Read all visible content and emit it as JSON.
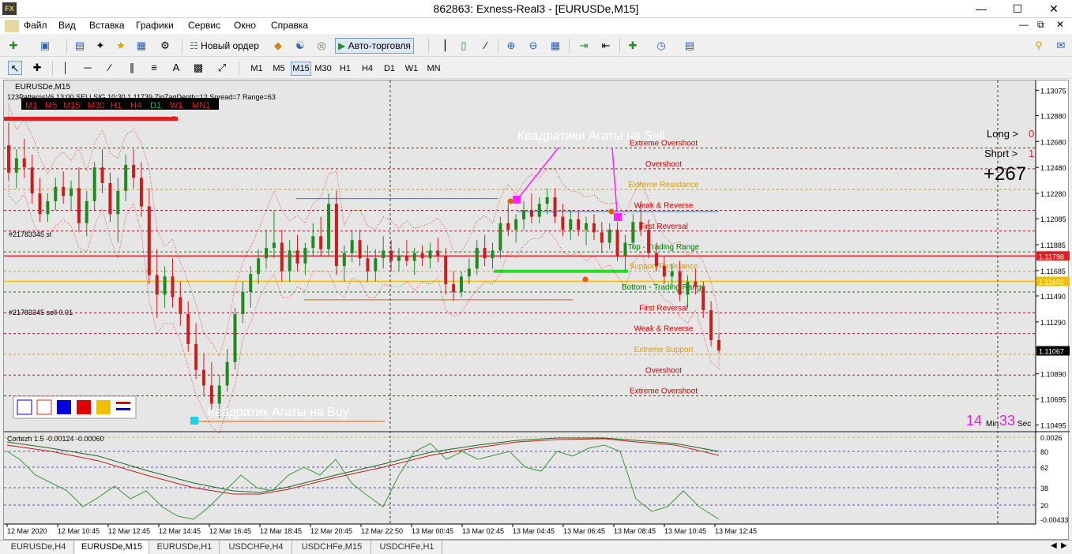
{
  "window": {
    "title": "862863: Exness-Real3 - [EURUSDe,M15]",
    "app_icon": "mt-app-icon",
    "controls": [
      "minimize-icon",
      "maximize-icon",
      "close-icon"
    ]
  },
  "menu": [
    "Файл",
    "Вид",
    "Вставка",
    "Графики",
    "Сервис",
    "Окно",
    "Справка"
  ],
  "toolbar": {
    "new_order": "Новый ордер",
    "autotrading": "Авто-торговля"
  },
  "timeframes": [
    "M1",
    "M5",
    "M15",
    "M30",
    "H1",
    "H4",
    "D1",
    "W1",
    "MN"
  ],
  "active_timeframe": "M15",
  "chart": {
    "symbol_header": "EURUSDe,M15",
    "info_line": "123PatternsV6  13:00  SELLSIG  10:30  1.11739  ZigZagDepth=12  Spread=7  Range=63",
    "tf_bar": [
      "M1",
      "M5",
      "M15",
      "M30",
      "H1",
      "H4",
      "D1",
      "W1",
      "MN1"
    ],
    "order_sl_label": "#21783345 sl",
    "order_label": "#21783345 sell 0.01",
    "annotation_sell": "Квадратики Агаты на Sell",
    "annotation_buy": "Квадратик Агаты на Buy",
    "long_label": "Long >",
    "long_value": "0",
    "short_label": "Short >",
    "short_value": "1",
    "profit": "+267",
    "timer_min": "14",
    "timer_min_label": "Min",
    "timer_sec": "33",
    "timer_sec_label": "Sec",
    "current_price": "1.11067",
    "bid_tag": "1.11798",
    "ask_tag": "1.11602",
    "levels": [
      {
        "label": "Extreme Overshoot",
        "price": 1.1263,
        "color": "#d40000"
      },
      {
        "label": "Overshoot",
        "price": 1.1247,
        "color": "#d40000"
      },
      {
        "label": "Extreme Resistance",
        "price": 1.1231,
        "color": "#d9a000"
      },
      {
        "label": "Weak & Reverse",
        "price": 1.1215,
        "color": "#d40000"
      },
      {
        "label": "First Reversal",
        "price": 1.1199,
        "color": "#d40000"
      },
      {
        "label": "Top - Trading Range",
        "price": 1.1183,
        "color": "#008000"
      },
      {
        "label": "Support/Resistance",
        "price": 1.1168,
        "color": "#d9a000"
      },
      {
        "label": "Bottom - Trading Range",
        "price": 1.1152,
        "color": "#008000"
      },
      {
        "label": "First Reversal",
        "price": 1.1136,
        "color": "#d40000"
      },
      {
        "label": "Weak & Reverse",
        "price": 1.112,
        "color": "#d40000"
      },
      {
        "label": "Extreme Support",
        "price": 1.1104,
        "color": "#d9a000"
      },
      {
        "label": "Overshoot",
        "price": 1.1088,
        "color": "#d40000"
      },
      {
        "label": "Extreme Overshoot",
        "price": 1.1072,
        "color": "#d40000"
      }
    ],
    "sub_window": {
      "label": "Cortezh 1.5 -0.00124 -0.00060",
      "axis": [
        "0.0026",
        "80",
        "62",
        "38",
        "20",
        "-0.00433"
      ]
    }
  },
  "chart_data": {
    "type": "candlestick",
    "price_axis": [
      "1.13075",
      "1.12880",
      "1.12680",
      "1.12480",
      "1.12280",
      "1.12085",
      "1.11885",
      "1.11685",
      "1.11490",
      "1.11290",
      "1.11090",
      "1.10890",
      "1.10695",
      "1.10495"
    ],
    "time_axis": [
      "12 Mar 2020",
      "12 Mar 10:45",
      "12 Mar 12:45",
      "12 Mar 14:45",
      "12 Mar 16:45",
      "12 Mar 18:45",
      "12 Mar 20:45",
      "12 Mar 22:50",
      "13 Mar 00:45",
      "13 Mar 02:45",
      "13 Mar 04:45",
      "13 Mar 06:45",
      "13 Mar 08:45",
      "13 Mar 10:45",
      "13 Mar 12:45"
    ],
    "ylim": [
      1.1045,
      1.1315
    ],
    "candles": [
      [
        1.1265,
        1.1282,
        1.1238,
        1.1244
      ],
      [
        1.1244,
        1.1262,
        1.1232,
        1.1255
      ],
      [
        1.1255,
        1.127,
        1.124,
        1.1248
      ],
      [
        1.1248,
        1.1258,
        1.122,
        1.1228
      ],
      [
        1.1228,
        1.124,
        1.1206,
        1.1212
      ],
      [
        1.1212,
        1.1228,
        1.1206,
        1.1222
      ],
      [
        1.1222,
        1.124,
        1.1215,
        1.1233
      ],
      [
        1.1233,
        1.1245,
        1.122,
        1.1226
      ],
      [
        1.1226,
        1.1238,
        1.1215,
        1.1232
      ],
      [
        1.1232,
        1.1248,
        1.1198,
        1.1205
      ],
      [
        1.1205,
        1.123,
        1.1195,
        1.1222
      ],
      [
        1.1222,
        1.1252,
        1.1215,
        1.1248
      ],
      [
        1.1248,
        1.1262,
        1.1228,
        1.1236
      ],
      [
        1.1236,
        1.1244,
        1.1206,
        1.1212
      ],
      [
        1.1212,
        1.124,
        1.119,
        1.123
      ],
      [
        1.123,
        1.1258,
        1.1222,
        1.125
      ],
      [
        1.125,
        1.1262,
        1.1232,
        1.124
      ],
      [
        1.124,
        1.1252,
        1.121,
        1.1218
      ],
      [
        1.1218,
        1.1232,
        1.1158,
        1.1165
      ],
      [
        1.1165,
        1.1185,
        1.1132,
        1.115
      ],
      [
        1.115,
        1.1172,
        1.114,
        1.1164
      ],
      [
        1.1164,
        1.1178,
        1.114,
        1.1148
      ],
      [
        1.1148,
        1.116,
        1.1126,
        1.1135
      ],
      [
        1.1135,
        1.1145,
        1.1106,
        1.1112
      ],
      [
        1.1112,
        1.1128,
        1.1085,
        1.1092
      ],
      [
        1.1092,
        1.1105,
        1.1072,
        1.108
      ],
      [
        1.108,
        1.1098,
        1.106,
        1.1066
      ],
      [
        1.1066,
        1.1088,
        1.1055,
        1.108
      ],
      [
        1.108,
        1.1108,
        1.1075,
        1.1098
      ],
      [
        1.1098,
        1.114,
        1.1092,
        1.1135
      ],
      [
        1.1135,
        1.116,
        1.1128,
        1.1152
      ],
      [
        1.1152,
        1.1172,
        1.114,
        1.1166
      ],
      [
        1.1166,
        1.1185,
        1.1158,
        1.1178
      ],
      [
        1.1178,
        1.12,
        1.117,
        1.1186
      ],
      [
        1.1186,
        1.1215,
        1.1178,
        1.119
      ],
      [
        1.119,
        1.12,
        1.116,
        1.1168
      ],
      [
        1.1168,
        1.1192,
        1.116,
        1.1184
      ],
      [
        1.1184,
        1.1196,
        1.1168,
        1.1174
      ],
      [
        1.1174,
        1.119,
        1.1165,
        1.1186
      ],
      [
        1.1186,
        1.1205,
        1.118,
        1.1195
      ],
      [
        1.1195,
        1.121,
        1.118,
        1.1185
      ],
      [
        1.1185,
        1.1228,
        1.118,
        1.122
      ],
      [
        1.122,
        1.123,
        1.1165,
        1.1172
      ],
      [
        1.1172,
        1.1188,
        1.116,
        1.1182
      ],
      [
        1.1182,
        1.12,
        1.1175,
        1.1192
      ],
      [
        1.1192,
        1.12,
        1.1172,
        1.1178
      ],
      [
        1.1178,
        1.1188,
        1.116,
        1.1168
      ],
      [
        1.1168,
        1.1185,
        1.116,
        1.1178
      ],
      [
        1.1178,
        1.1195,
        1.117,
        1.1184
      ],
      [
        1.1184,
        1.1192,
        1.1168,
        1.1176
      ],
      [
        1.1176,
        1.1186,
        1.1168,
        1.118
      ],
      [
        1.118,
        1.1192,
        1.1172,
        1.1176
      ],
      [
        1.1176,
        1.1186,
        1.1165,
        1.1182
      ],
      [
        1.1182,
        1.1188,
        1.1172,
        1.1178
      ],
      [
        1.1178,
        1.119,
        1.117,
        1.1184
      ],
      [
        1.1184,
        1.1194,
        1.1175,
        1.118
      ],
      [
        1.118,
        1.1186,
        1.115,
        1.1158
      ],
      [
        1.1158,
        1.1168,
        1.1145,
        1.1152
      ],
      [
        1.1152,
        1.1168,
        1.1148,
        1.1164
      ],
      [
        1.1164,
        1.1178,
        1.1158,
        1.117
      ],
      [
        1.117,
        1.1192,
        1.1165,
        1.1186
      ],
      [
        1.1186,
        1.1196,
        1.1172,
        1.1178
      ],
      [
        1.1178,
        1.119,
        1.117,
        1.1184
      ],
      [
        1.1184,
        1.121,
        1.1178,
        1.1205
      ],
      [
        1.1205,
        1.122,
        1.1195,
        1.12
      ],
      [
        1.12,
        1.1212,
        1.119,
        1.1208
      ],
      [
        1.1208,
        1.1222,
        1.12,
        1.1215
      ],
      [
        1.1215,
        1.1228,
        1.1205,
        1.121
      ],
      [
        1.121,
        1.1225,
        1.1205,
        1.122
      ],
      [
        1.122,
        1.1232,
        1.1212,
        1.1225
      ],
      [
        1.1225,
        1.1232,
        1.1205,
        1.121
      ],
      [
        1.121,
        1.122,
        1.1195,
        1.12
      ],
      [
        1.12,
        1.1215,
        1.1192,
        1.1208
      ],
      [
        1.1208,
        1.1214,
        1.1195,
        1.12
      ],
      [
        1.12,
        1.121,
        1.1188,
        1.1205
      ],
      [
        1.1205,
        1.1212,
        1.1192,
        1.1198
      ],
      [
        1.1198,
        1.1206,
        1.1182,
        1.119
      ],
      [
        1.119,
        1.1205,
        1.1185,
        1.12
      ],
      [
        1.12,
        1.1206,
        1.1176,
        1.118
      ],
      [
        1.118,
        1.1196,
        1.1168,
        1.119
      ],
      [
        1.119,
        1.1212,
        1.1186,
        1.1206
      ],
      [
        1.1206,
        1.1222,
        1.1195,
        1.12
      ],
      [
        1.12,
        1.1208,
        1.1178,
        1.1182
      ],
      [
        1.1182,
        1.119,
        1.1168,
        1.1172
      ],
      [
        1.1172,
        1.118,
        1.1158,
        1.1164
      ],
      [
        1.1164,
        1.1174,
        1.1155,
        1.1168
      ],
      [
        1.1168,
        1.1176,
        1.1145,
        1.115
      ],
      [
        1.115,
        1.1165,
        1.114,
        1.116
      ],
      [
        1.116,
        1.117,
        1.115,
        1.1156
      ],
      [
        1.1156,
        1.116,
        1.1132,
        1.1138
      ],
      [
        1.1138,
        1.1145,
        1.111,
        1.1115
      ],
      [
        1.1115,
        1.112,
        1.1105,
        1.1107
      ]
    ],
    "subwindow_series": [
      "Cortezh main",
      "signal",
      "green oscillator"
    ]
  }
}
